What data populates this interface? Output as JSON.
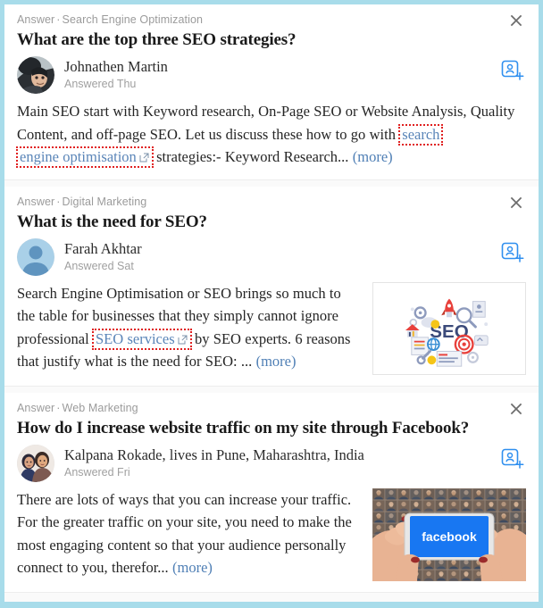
{
  "feed": {
    "cards": [
      {
        "type_label": "Answer",
        "topic": "Search Engine Optimization",
        "close_label": "✕",
        "question": "What are the top three SEO strategies?",
        "author": {
          "name": "Johnathen Martin",
          "answered": "Answered Thu",
          "avatar": "photo-helmet-person"
        },
        "follow_icon": "add-person-icon",
        "body": {
          "lead": "Main SEO start with Keyword research, On-Page SEO or Website Analysis, Quality Content, and off-page SEO. Let us discuss these how to go with ",
          "link_a": "search",
          "mid": " ",
          "link_b": "engine optimisation",
          "tail": " strategies:- Keyword Research... ",
          "more": "(more)"
        },
        "thumbnail": null
      },
      {
        "type_label": "Answer",
        "topic": "Digital Marketing",
        "close_label": "✕",
        "question": "What is the need for SEO?",
        "author": {
          "name": "Farah Akhtar",
          "answered": "Answered Sat",
          "avatar": "default-blue-avatar"
        },
        "follow_icon": "add-person-icon",
        "body": {
          "lead": "Search Engine Optimisation or SEO brings so much to the table for businesses that they simply cannot ignore professional ",
          "link_a": "SEO services",
          "mid": "",
          "link_b": "",
          "tail": " by SEO experts. 6 reasons that justify what is the need for SEO: ... ",
          "more": "(more)"
        },
        "thumbnail": {
          "kind": "seo-illustration",
          "alt_text": "SEO",
          "framed": true
        }
      },
      {
        "type_label": "Answer",
        "topic": "Web Marketing",
        "close_label": "✕",
        "question": "How do I increase website traffic on my site through Facebook?",
        "author": {
          "name": "Kalpana Rokade, lives in Pune, Maharashtra, India",
          "answered": "Answered Fri",
          "avatar": "photo-two-women"
        },
        "follow_icon": "add-person-icon",
        "body": {
          "lead": "There are lots of ways that you can increase your traffic. For the greater traffic on your site, you need to make the most engaging content so that your audience personally connect to you, therefor... ",
          "link_a": "",
          "mid": "",
          "link_b": "",
          "tail": "",
          "more": "(more)"
        },
        "thumbnail": {
          "kind": "facebook-phone-photo",
          "alt_text": "facebook",
          "framed": false
        }
      }
    ]
  },
  "colors": {
    "page_border": "#a8dcea",
    "link": "#5a85b8",
    "highlight_box": "#e02020",
    "breadcrumb_text": "#9b9b9b",
    "title_text": "#1a1a1a",
    "body_text": "#252525",
    "accent_blue": "#2f8fef",
    "facebook_blue": "#1877f2"
  }
}
